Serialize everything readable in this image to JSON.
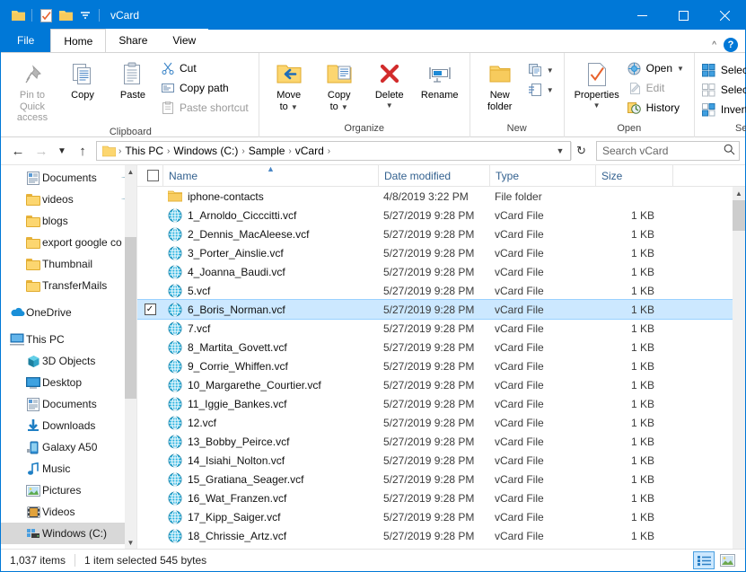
{
  "window": {
    "title": "vCard",
    "quick_access": [
      "folder-icon",
      "properties-icon",
      "new-folder-icon",
      "customize-dropdown-icon"
    ],
    "controls": {
      "minimize": "—",
      "maximize": "☐",
      "close": "✕"
    }
  },
  "tabs": [
    {
      "label": "File",
      "id": "file"
    },
    {
      "label": "Home",
      "id": "home"
    },
    {
      "label": "Share",
      "id": "share"
    },
    {
      "label": "View",
      "id": "view"
    }
  ],
  "active_tab": "Home",
  "ribbon": {
    "groups": [
      {
        "label": "Clipboard",
        "big_buttons": [
          {
            "label": "Pin to Quick\naccess",
            "line1": "Pin to Quick",
            "line2": "access",
            "icon": "pin-icon",
            "disabled": true
          },
          {
            "label": "Copy",
            "line1": "Copy",
            "line2": "",
            "icon": "copy-icon",
            "disabled": false
          },
          {
            "label": "Paste",
            "line1": "Paste",
            "line2": "",
            "icon": "paste-icon",
            "disabled": false
          }
        ],
        "small_buttons": [
          {
            "label": "Cut",
            "icon": "scissors-icon",
            "disabled": false
          },
          {
            "label": "Copy path",
            "icon": "copy-path-icon",
            "disabled": false
          },
          {
            "label": "Paste shortcut",
            "icon": "paste-shortcut-icon",
            "disabled": true
          }
        ]
      },
      {
        "label": "Organize",
        "big_buttons": [
          {
            "line1": "Move",
            "line2": "to",
            "icon": "move-to-icon",
            "dropdown": true
          },
          {
            "line1": "Copy",
            "line2": "to",
            "icon": "copy-to-icon",
            "dropdown": true
          },
          {
            "line1": "Delete",
            "line2": "",
            "icon": "delete-icon",
            "dropdown": true
          },
          {
            "line1": "Rename",
            "line2": "",
            "icon": "rename-icon",
            "dropdown": false
          }
        ]
      },
      {
        "label": "New",
        "big_buttons": [
          {
            "line1": "New",
            "line2": "folder",
            "icon": "new-folder-icon",
            "dropdown": false
          }
        ],
        "small_buttons": [
          {
            "label": "",
            "icon": "new-item-icon",
            "dropdown": true
          },
          {
            "label": "",
            "icon": "easy-access-icon",
            "dropdown": true
          }
        ]
      },
      {
        "label": "Open",
        "big_buttons": [
          {
            "line1": "Properties",
            "line2": "",
            "icon": "properties-icon",
            "dropdown": true
          }
        ],
        "small_buttons": [
          {
            "label": "Open",
            "icon": "open-icon",
            "dropdown": true,
            "disabled": false
          },
          {
            "label": "Edit",
            "icon": "edit-icon",
            "disabled": true
          },
          {
            "label": "History",
            "icon": "history-icon",
            "disabled": false
          }
        ]
      },
      {
        "label": "Select",
        "small_buttons": [
          {
            "label": "Select all",
            "icon": "select-all-icon"
          },
          {
            "label": "Select none",
            "icon": "select-none-icon"
          },
          {
            "label": "Invert selection",
            "icon": "invert-selection-icon"
          }
        ]
      }
    ]
  },
  "address": {
    "back_icon": "back-arrow-icon",
    "forward_icon": "forward-arrow-icon",
    "recent_icon": "chevron-down-icon",
    "up_icon": "up-arrow-icon",
    "crumbs": [
      "This PC",
      "Windows (C:)",
      "Sample",
      "vCard"
    ],
    "separator": "›",
    "dropdown_icon": "chevron-down-icon",
    "refresh_icon": "refresh-icon"
  },
  "search": {
    "placeholder": "Search vCard",
    "value": "",
    "icon": "search-icon"
  },
  "sidebar": {
    "items": [
      {
        "label": "Documents",
        "icon": "documents-icon",
        "level": 1,
        "pinned": true,
        "selected": false
      },
      {
        "label": "videos",
        "icon": "folder-icon",
        "level": 1,
        "pinned": true,
        "selected": false
      },
      {
        "label": "blogs",
        "icon": "folder-icon",
        "level": 1,
        "pinned": false,
        "selected": false
      },
      {
        "label": "export google co",
        "icon": "folder-icon",
        "level": 1,
        "pinned": false,
        "selected": false
      },
      {
        "label": "Thumbnail",
        "icon": "folder-icon",
        "level": 1,
        "pinned": false,
        "selected": false
      },
      {
        "label": "TransferMails",
        "icon": "folder-icon",
        "level": 1,
        "pinned": false,
        "selected": false
      },
      {
        "label": "OneDrive",
        "icon": "onedrive-icon",
        "level": 0,
        "pinned": false,
        "selected": false
      },
      {
        "label": "This PC",
        "icon": "this-pc-icon",
        "level": 0,
        "pinned": false,
        "selected": false
      },
      {
        "label": "3D Objects",
        "icon": "3d-objects-icon",
        "level": 1,
        "pinned": false,
        "selected": false
      },
      {
        "label": "Desktop",
        "icon": "desktop-icon",
        "level": 1,
        "pinned": false,
        "selected": false
      },
      {
        "label": "Documents",
        "icon": "documents-icon",
        "level": 1,
        "pinned": false,
        "selected": false
      },
      {
        "label": "Downloads",
        "icon": "downloads-icon",
        "level": 1,
        "pinned": false,
        "selected": false
      },
      {
        "label": "Galaxy A50",
        "icon": "phone-icon",
        "level": 1,
        "pinned": false,
        "selected": false
      },
      {
        "label": "Music",
        "icon": "music-icon",
        "level": 1,
        "pinned": false,
        "selected": false
      },
      {
        "label": "Pictures",
        "icon": "pictures-icon",
        "level": 1,
        "pinned": false,
        "selected": false
      },
      {
        "label": "Videos",
        "icon": "videos-icon",
        "level": 1,
        "pinned": false,
        "selected": false
      },
      {
        "label": "Windows (C:)",
        "icon": "drive-icon",
        "level": 1,
        "pinned": false,
        "selected": true
      }
    ]
  },
  "filelist": {
    "columns": [
      "Name",
      "Date modified",
      "Type",
      "Size"
    ],
    "sorted_by": "Name",
    "sort_direction": "ascending",
    "rows": [
      {
        "name": "iphone-contacts",
        "date": "4/8/2019 3:22 PM",
        "type": "File folder",
        "size": "",
        "icon": "folder-icon",
        "selected": false
      },
      {
        "name": "1_Arnoldo_Cicccitti.vcf",
        "date": "5/27/2019 9:28 PM",
        "type": "vCard File",
        "size": "1 KB",
        "icon": "vcard-icon",
        "selected": false
      },
      {
        "name": "2_Dennis_MacAleese.vcf",
        "date": "5/27/2019 9:28 PM",
        "type": "vCard File",
        "size": "1 KB",
        "icon": "vcard-icon",
        "selected": false
      },
      {
        "name": "3_Porter_Ainslie.vcf",
        "date": "5/27/2019 9:28 PM",
        "type": "vCard File",
        "size": "1 KB",
        "icon": "vcard-icon",
        "selected": false
      },
      {
        "name": "4_Joanna_Baudi.vcf",
        "date": "5/27/2019 9:28 PM",
        "type": "vCard File",
        "size": "1 KB",
        "icon": "vcard-icon",
        "selected": false
      },
      {
        "name": "5.vcf",
        "date": "5/27/2019 9:28 PM",
        "type": "vCard File",
        "size": "1 KB",
        "icon": "vcard-icon",
        "selected": false
      },
      {
        "name": "6_Boris_Norman.vcf",
        "date": "5/27/2019 9:28 PM",
        "type": "vCard File",
        "size": "1 KB",
        "icon": "vcard-icon",
        "selected": true
      },
      {
        "name": "7.vcf",
        "date": "5/27/2019 9:28 PM",
        "type": "vCard File",
        "size": "1 KB",
        "icon": "vcard-icon",
        "selected": false
      },
      {
        "name": "8_Martita_Govett.vcf",
        "date": "5/27/2019 9:28 PM",
        "type": "vCard File",
        "size": "1 KB",
        "icon": "vcard-icon",
        "selected": false
      },
      {
        "name": "9_Corrie_Whiffen.vcf",
        "date": "5/27/2019 9:28 PM",
        "type": "vCard File",
        "size": "1 KB",
        "icon": "vcard-icon",
        "selected": false
      },
      {
        "name": "10_Margarethe_Courtier.vcf",
        "date": "5/27/2019 9:28 PM",
        "type": "vCard File",
        "size": "1 KB",
        "icon": "vcard-icon",
        "selected": false
      },
      {
        "name": "11_Iggie_Bankes.vcf",
        "date": "5/27/2019 9:28 PM",
        "type": "vCard File",
        "size": "1 KB",
        "icon": "vcard-icon",
        "selected": false
      },
      {
        "name": "12.vcf",
        "date": "5/27/2019 9:28 PM",
        "type": "vCard File",
        "size": "1 KB",
        "icon": "vcard-icon",
        "selected": false
      },
      {
        "name": "13_Bobby_Peirce.vcf",
        "date": "5/27/2019 9:28 PM",
        "type": "vCard File",
        "size": "1 KB",
        "icon": "vcard-icon",
        "selected": false
      },
      {
        "name": "14_Isiahi_Nolton.vcf",
        "date": "5/27/2019 9:28 PM",
        "type": "vCard File",
        "size": "1 KB",
        "icon": "vcard-icon",
        "selected": false
      },
      {
        "name": "15_Gratiana_Seager.vcf",
        "date": "5/27/2019 9:28 PM",
        "type": "vCard File",
        "size": "1 KB",
        "icon": "vcard-icon",
        "selected": false
      },
      {
        "name": "16_Wat_Franzen.vcf",
        "date": "5/27/2019 9:28 PM",
        "type": "vCard File",
        "size": "1 KB",
        "icon": "vcard-icon",
        "selected": false
      },
      {
        "name": "17_Kipp_Saiger.vcf",
        "date": "5/27/2019 9:28 PM",
        "type": "vCard File",
        "size": "1 KB",
        "icon": "vcard-icon",
        "selected": false
      },
      {
        "name": "18_Chrissie_Artz.vcf",
        "date": "5/27/2019 9:28 PM",
        "type": "vCard File",
        "size": "1 KB",
        "icon": "vcard-icon",
        "selected": false
      }
    ]
  },
  "statusbar": {
    "item_count": "1,037 items",
    "selection": "1 item selected  545 bytes",
    "views": [
      {
        "name": "details-view",
        "active": true
      },
      {
        "name": "large-icons-view",
        "active": false
      }
    ]
  },
  "colors": {
    "accent": "#0078d7",
    "selection": "#cce8ff",
    "folder": "#fcd670",
    "vcard": "#29abe2",
    "header_text": "#33618f"
  }
}
